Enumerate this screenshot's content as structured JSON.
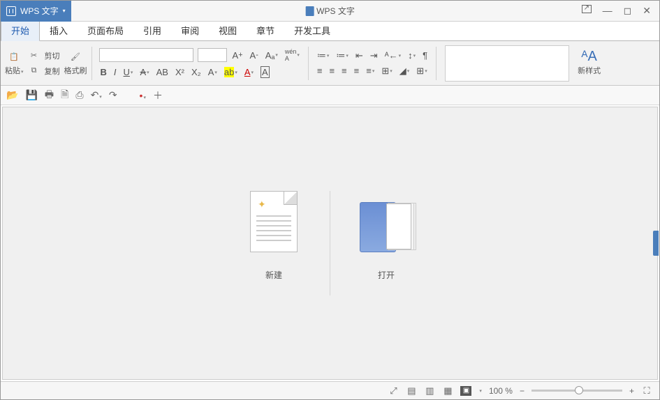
{
  "titlebar": {
    "brand": "WPS 文字",
    "doc_title": "WPS 文字"
  },
  "menu": {
    "tabs": [
      "开始",
      "插入",
      "页面布局",
      "引用",
      "审阅",
      "视图",
      "章节",
      "开发工具"
    ],
    "active": 0
  },
  "ribbon": {
    "cut": "剪切",
    "paste": "粘贴",
    "copy": "复制",
    "format_painter": "格式刷",
    "new_style": "新样式"
  },
  "start": {
    "new": "新建",
    "open": "打开"
  },
  "status": {
    "zoom": "100 %"
  }
}
